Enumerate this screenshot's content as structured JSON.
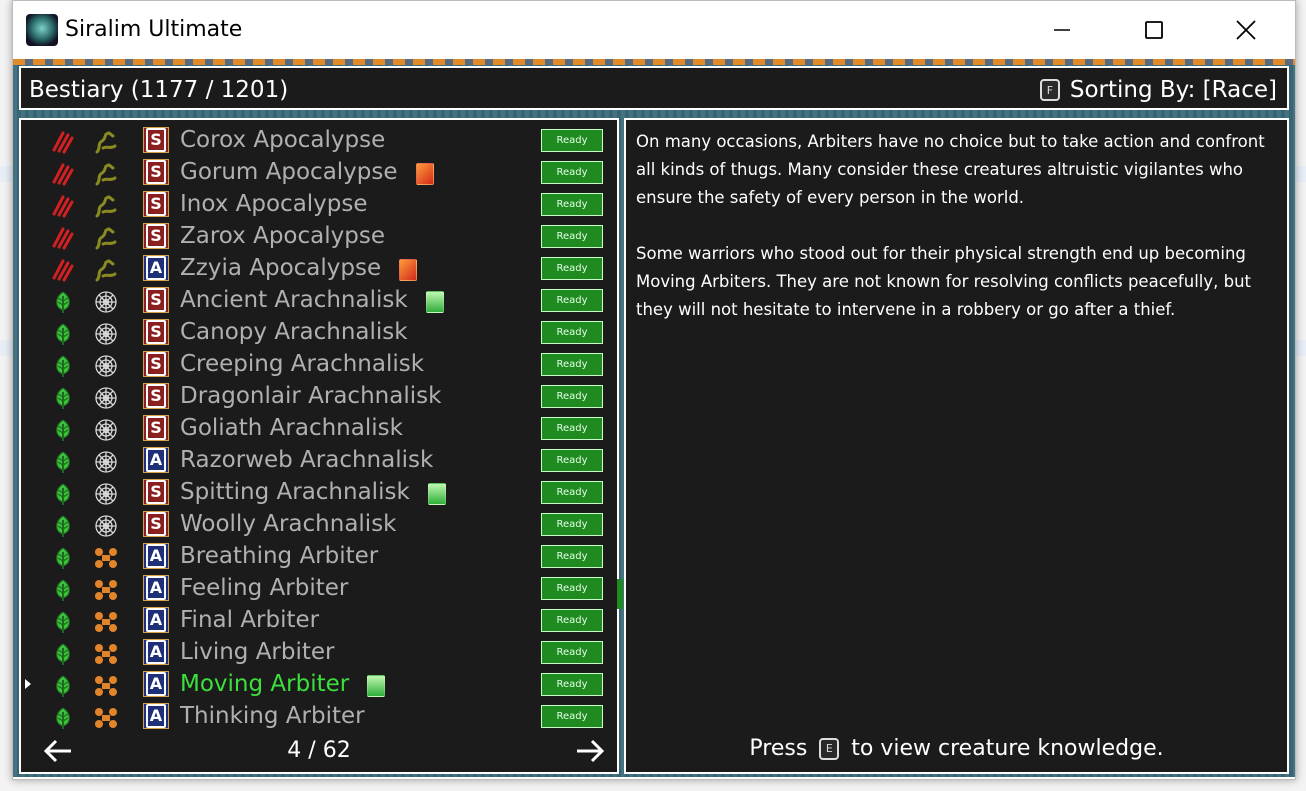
{
  "window": {
    "title": "Siralim Ultimate"
  },
  "bestiary": {
    "title": "Bestiary (1177 / 1201)",
    "sort_key": "F",
    "sort_label": "Sorting By: [Race]"
  },
  "creatures": [
    {
      "name": "Corox Apocalypse",
      "race": "claw",
      "trait": "serpent",
      "rank": "S",
      "extra": null,
      "status": "Ready"
    },
    {
      "name": "Gorum Apocalypse",
      "race": "claw",
      "trait": "serpent",
      "rank": "S",
      "extra": "red",
      "status": "Ready"
    },
    {
      "name": "Inox Apocalypse",
      "race": "claw",
      "trait": "serpent",
      "rank": "S",
      "extra": null,
      "status": "Ready"
    },
    {
      "name": "Zarox Apocalypse",
      "race": "claw",
      "trait": "serpent",
      "rank": "S",
      "extra": null,
      "status": "Ready"
    },
    {
      "name": "Zzyia Apocalypse",
      "race": "claw",
      "trait": "serpent",
      "rank": "A",
      "extra": "red",
      "status": "Ready"
    },
    {
      "name": "Ancient Arachnalisk",
      "race": "leaf",
      "trait": "web",
      "rank": "S",
      "extra": "green",
      "status": "Ready"
    },
    {
      "name": "Canopy Arachnalisk",
      "race": "leaf",
      "trait": "web",
      "rank": "S",
      "extra": null,
      "status": "Ready"
    },
    {
      "name": "Creeping Arachnalisk",
      "race": "leaf",
      "trait": "web",
      "rank": "S",
      "extra": null,
      "status": "Ready"
    },
    {
      "name": "Dragonlair Arachnalisk",
      "race": "leaf",
      "trait": "web",
      "rank": "S",
      "extra": null,
      "status": "Ready"
    },
    {
      "name": "Goliath Arachnalisk",
      "race": "leaf",
      "trait": "web",
      "rank": "S",
      "extra": null,
      "status": "Ready"
    },
    {
      "name": "Razorweb Arachnalisk",
      "race": "leaf",
      "trait": "web",
      "rank": "A",
      "extra": null,
      "status": "Ready"
    },
    {
      "name": "Spitting Arachnalisk",
      "race": "leaf",
      "trait": "web",
      "rank": "S",
      "extra": "green",
      "status": "Ready"
    },
    {
      "name": "Woolly Arachnalisk",
      "race": "leaf",
      "trait": "web",
      "rank": "S",
      "extra": null,
      "status": "Ready"
    },
    {
      "name": "Breathing Arbiter",
      "race": "leaf",
      "trait": "arbiter",
      "rank": "A",
      "extra": null,
      "status": "Ready"
    },
    {
      "name": "Feeling Arbiter",
      "race": "leaf",
      "trait": "arbiter",
      "rank": "A",
      "extra": null,
      "status": "Ready"
    },
    {
      "name": "Final Arbiter",
      "race": "leaf",
      "trait": "arbiter",
      "rank": "A",
      "extra": null,
      "status": "Ready"
    },
    {
      "name": "Living Arbiter",
      "race": "leaf",
      "trait": "arbiter",
      "rank": "A",
      "extra": null,
      "status": "Ready"
    },
    {
      "name": "Moving Arbiter",
      "race": "leaf",
      "trait": "arbiter",
      "rank": "A",
      "extra": "green",
      "status": "Ready",
      "selected": true
    },
    {
      "name": "Thinking Arbiter",
      "race": "leaf",
      "trait": "arbiter",
      "rank": "A",
      "extra": null,
      "status": "Ready"
    }
  ],
  "pager": {
    "label": "4 / 62"
  },
  "description": {
    "para1": "On many occasions, Arbiters have no choice but to take action and confront all kinds of thugs. Many consider these creatures altruistic vigilantes who ensure the safety of every person in the world.",
    "para2": "Some warriors who stood out for their physical strength end up becoming Moving Arbiters. They are not known for resolving conflicts peacefully, but they will not hesitate to intervene in a robbery or go after a thief."
  },
  "hint": {
    "press": "Press",
    "key": "E",
    "action": "to view creature knowledge."
  },
  "colors": {
    "selected": "#3be03b",
    "ready": "#1f8a1f",
    "panel": "#1b1b1b"
  }
}
